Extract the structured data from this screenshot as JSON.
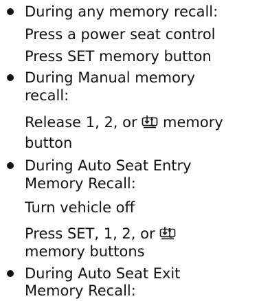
{
  "items": [
    {
      "heading": [
        "During any memory recall:"
      ],
      "steps": [
        [
          "Press a power seat control"
        ],
        [
          "Press SET memory button"
        ]
      ]
    },
    {
      "heading": [
        "During Manual memory",
        "recall:"
      ],
      "steps": [
        [
          "Release 1, 2, or",
          "memory",
          "button"
        ]
      ]
    },
    {
      "heading": [
        "During Auto Seat Entry",
        "Memory Recall:"
      ],
      "steps": [
        [
          "Turn vehicle off"
        ],
        [
          "Press SET, 1, 2, or",
          "memory buttons"
        ]
      ]
    },
    {
      "heading": [
        "During Auto Seat Exit",
        "Memory Recall:"
      ],
      "steps": []
    }
  ],
  "icons": {
    "seat_memory_icon": "driver-seat-memory-icon"
  }
}
